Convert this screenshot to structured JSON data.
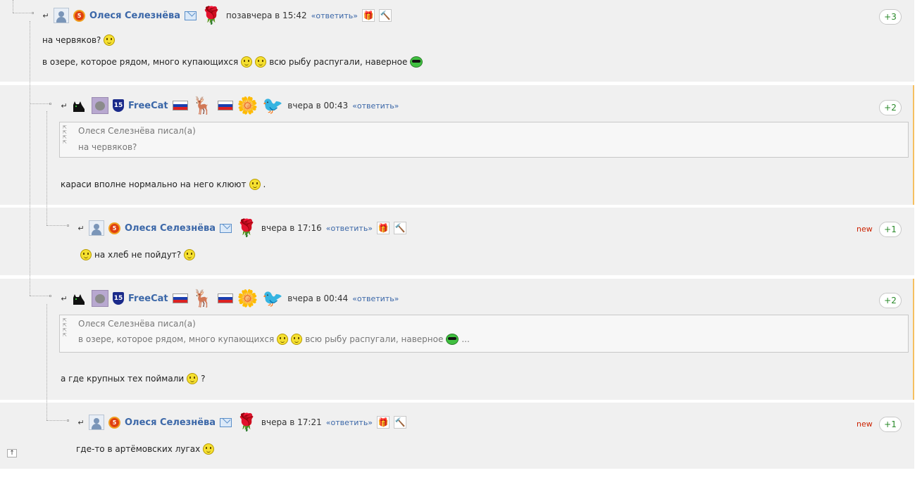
{
  "comments": [
    {
      "id": "c1",
      "author": "Олеся Селезнёва",
      "time": "позавчера в 15:42",
      "reply": "«ответить»",
      "score": "+3",
      "new": "",
      "lines": [
        "на червяков?",
        "в озере, которое рядом, много купающихся",
        "всю рыбу распугали, наверное"
      ]
    },
    {
      "id": "c2",
      "author": "FreeCat",
      "time": "вчера в 00:43",
      "reply": "«ответить»",
      "score": "+2",
      "quote_author": "Олеся Селезнёва писал(а)",
      "quote_text": "на червяков?",
      "text": "караси вполне нормально на него клюют",
      "text_tail": "."
    },
    {
      "id": "c3",
      "author": "Олеся Селезнёва",
      "time": "вчера в 17:16",
      "reply": "«ответить»",
      "score": "+1",
      "new": "new",
      "text": "на хлеб не пойдут?"
    },
    {
      "id": "c4",
      "author": "FreeCat",
      "time": "вчера в 00:44",
      "reply": "«ответить»",
      "score": "+2",
      "quote_author": "Олеся Селезнёва писал(а)",
      "quote_text_a": "в озере, которое рядом, много купающихся",
      "quote_text_b": "всю рыбу распугали, наверное",
      "quote_tail": "...",
      "text": "а где крупных тех поймали",
      "text_tail": "?"
    },
    {
      "id": "c5",
      "author": "Олеся Селезнёва",
      "time": "вчера в 17:21",
      "reply": "«ответить»",
      "score": "+1",
      "new": "new",
      "text": "где-то в артёмовских лугах"
    }
  ],
  "badges": {
    "medal": "5",
    "shield": "15"
  },
  "icons": {
    "back": "↵",
    "up": "↑",
    "gift": "gift-icon",
    "gavel": "gavel-icon",
    "rose": "rose-icon",
    "daisy": "daisy-icon",
    "deer": "deer-icon",
    "bird": "bird-icon"
  },
  "colors": {
    "username": "#3b67a8",
    "score": "#2a8a2a",
    "new": "#cc2200",
    "panel": "#f0f0f0"
  }
}
